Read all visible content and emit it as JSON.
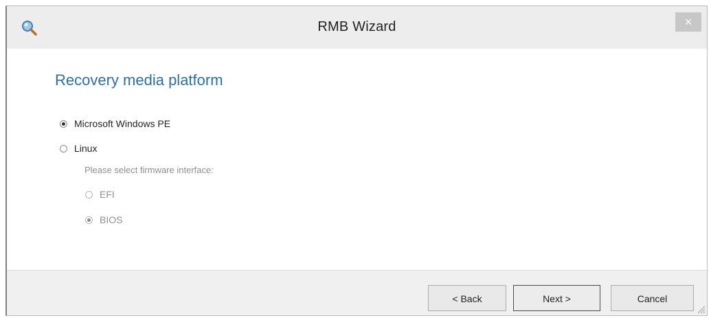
{
  "window": {
    "title": "RMB Wizard",
    "close_glyph": "×"
  },
  "content": {
    "heading": "Recovery media platform",
    "platforms": [
      {
        "label": "Microsoft Windows PE",
        "selected": true
      },
      {
        "label": "Linux",
        "selected": false
      }
    ],
    "firmware_prompt": "Please select firmware interface:",
    "firmware": [
      {
        "label": "EFI",
        "selected": false,
        "enabled": false
      },
      {
        "label": "BIOS",
        "selected": true,
        "enabled": false
      }
    ]
  },
  "footer": {
    "back_label": "< Back",
    "next_label": "Next >",
    "cancel_label": "Cancel"
  },
  "colors": {
    "heading": "#2f6f9f",
    "titlebar": "#ededed",
    "footer": "#f0f0f0"
  },
  "icons": {
    "app": "search-icon",
    "close": "close-icon",
    "grip": "resize-grip-icon"
  }
}
